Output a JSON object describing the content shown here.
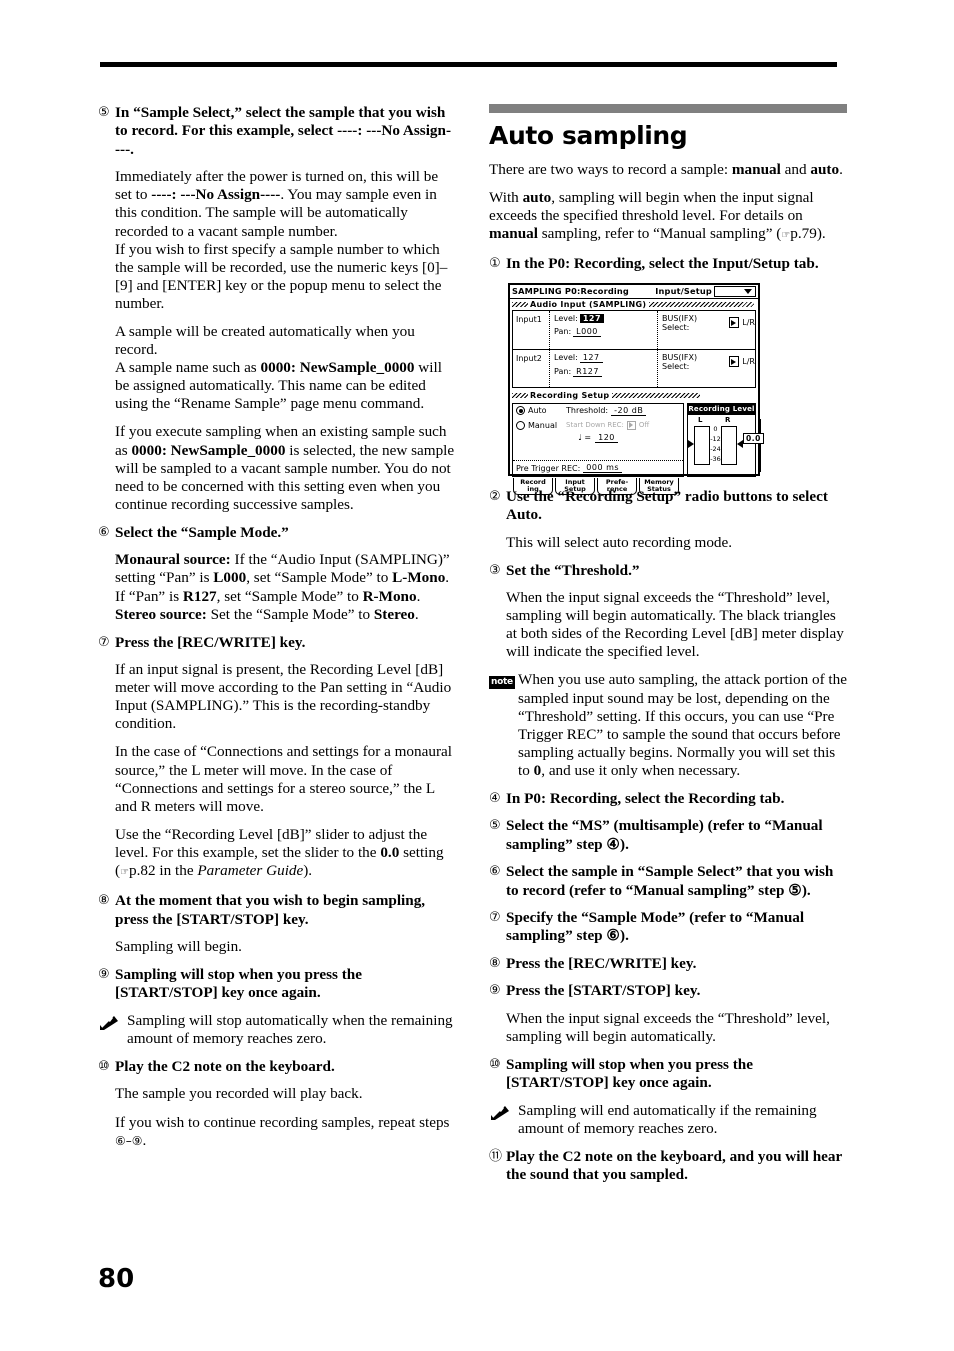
{
  "page_number": "80",
  "left_column": {
    "steps": [
      {
        "num": "⑤",
        "heading": "In “Sample Select,” select the sample that you wish to record. For this example, select ----: ---No Assign----.",
        "paragraphs": [
          "Immediately after the power is turned on, this will be set to ----: ---No Assign----. You may sample even in this condition. The sample will be automatically recorded to a vacant sample number.\nIf you wish to first specify a sample number to which the sample will be recorded, use the numeric keys [0]–[9] and [ENTER] key or the popup menu to select the number.",
          "A sample will be created automatically when you record.\nA sample name such as 0000: NewSample_0000 will be assigned automatically. This name can be edited using the “Rename Sample” page menu command.",
          "If you execute sampling when an existing sample such as 0000: NewSample_0000 is selected, the new sample will be sampled to a vacant sample number. You do not need to be concerned with this setting even when you continue recording successive samples."
        ]
      },
      {
        "num": "⑥",
        "heading": "Select the “Sample Mode.”",
        "paragraphs": [
          "Monaural source: If the “Audio Input (SAMPLING)” setting “Pan” is L000, set “Sample Mode” to L-Mono. If “Pan” is R127, set “Sample Mode” to R-Mono.\nStereo source: Set the “Sample Mode” to Stereo."
        ]
      },
      {
        "num": "⑦",
        "heading": "Press the [REC/WRITE] key.",
        "paragraphs": [
          "If an input signal is present, the Recording Level [dB] meter will move according to the Pan setting in “Audio Input (SAMPLING).” This is the recording-standby condition.",
          "In the case of “Connections and settings for a monaural source,” the L meter will move. In the case of “Connections and settings for a stereo source,” the L and R meters will move.",
          "Use the “Recording Level [dB]” slider to adjust the level. For this example, set the slider to the 0.0 setting (☚p.82 in the Parameter Guide)."
        ]
      },
      {
        "num": "⑧",
        "heading": "At the moment that you wish to begin sampling, press the [START/STOP] key.",
        "paragraphs": [
          "Sampling will begin."
        ]
      },
      {
        "num": "⑨",
        "heading": "Sampling will stop when you press the [START/STOP] key once again.",
        "paragraphs": []
      }
    ],
    "warning_note": "Sampling will stop automatically when the remaining amount of memory reaches zero.",
    "final_step": {
      "num": "⑩",
      "heading": "Play the C2 note on the keyboard.",
      "paragraphs": [
        "The sample you recorded will play back.",
        "If you wish to continue recording samples, repeat steps ⑥–⑨."
      ]
    }
  },
  "right_column": {
    "section_title": "Auto sampling",
    "intro": [
      "There are two ways to record a sample: manual and auto.",
      "With auto, sampling will begin when the input signal exceeds the specified threshold level. For details on manual sampling, refer to “Manual sampling” (☚p.79)."
    ],
    "step1": {
      "num": "①",
      "heading": "In the P0: Recording, select the Input/Setup tab."
    },
    "steps_after": [
      {
        "num": "②",
        "heading": "Use the “Recording Setup” radio buttons to select Auto.",
        "paragraphs": [
          "This will select auto recording mode."
        ]
      },
      {
        "num": "③",
        "heading": "Set the “Threshold.”",
        "paragraphs": [
          "When the input signal exceeds the “Threshold” level, sampling will begin automatically. The black triangles at both sides of the Recording Level [dB] meter display will indicate the specified level."
        ]
      }
    ],
    "note_badge": "note",
    "note_text": "When you use auto sampling, the attack portion of the sampled input sound may be lost, depending on the “Threshold” setting. If this occurs, you can use “Pre Trigger REC” to sample the sound that occurs before sampling actually begins. Normally you will set this to 0, and use it only when necessary.",
    "steps_tail": [
      {
        "num": "④",
        "heading": "In P0: Recording, select the Recording tab.",
        "paragraphs": []
      },
      {
        "num": "⑤",
        "heading": "Select the “MS” (multisample) (refer to “Manual sampling” step ④).",
        "paragraphs": []
      },
      {
        "num": "⑥",
        "heading": "Select the sample in “Sample Select” that you wish to record (refer to “Manual sampling” step ⑤).",
        "paragraphs": []
      },
      {
        "num": "⑦",
        "heading": "Specify the “Sample Mode” (refer to “Manual sampling” step ⑥).",
        "paragraphs": []
      },
      {
        "num": "⑧",
        "heading": "Press the [REC/WRITE] key.",
        "paragraphs": []
      },
      {
        "num": "⑨",
        "heading": "Press the [START/STOP] key.",
        "paragraphs": [
          "When the input signal exceeds the “Threshold” level, sampling will begin automatically."
        ]
      },
      {
        "num": "⑩",
        "heading": "Sampling will stop when you press the [START/STOP] key once again.",
        "paragraphs": []
      }
    ],
    "warning_note": "Sampling will end automatically if the remaining amount of memory reaches zero.",
    "last_step": {
      "num": "⑪",
      "heading": "Play the C2 note on the keyboard, and you will hear the sound that you sampled."
    }
  },
  "lcd": {
    "title_left": "SAMPLING P0:Recording",
    "title_right": "Input/Setup",
    "audio_group_label": "Audio Input (SAMPLING)",
    "inputs": [
      {
        "name": "Input1",
        "level_label": "Level:",
        "level_value": "127",
        "level_selected": true,
        "pan_label": "Pan:",
        "pan_value": "L000",
        "bus_label": "BUS(IFX) Select:",
        "bus_value": "L/R"
      },
      {
        "name": "Input2",
        "level_label": "Level:",
        "level_value": "127",
        "level_selected": false,
        "pan_label": "Pan:",
        "pan_value": "R127",
        "bus_label": "BUS(IFX) Select:",
        "bus_value": "L/R"
      }
    ],
    "recording_group_label": "Recording Setup",
    "auto_label": "Auto",
    "auto_selected": true,
    "threshold_label": "Threshold:",
    "threshold_value": "-20 dB",
    "manual_label": "Manual",
    "manual_selected": false,
    "manual_dim_label": "Start Down REC:",
    "manual_dim_value": "Off",
    "tempo_label": "♩ =",
    "tempo_value": "120",
    "pretrigger_label": "Pre Trigger REC:",
    "pretrigger_value": "000 ms",
    "meter_title": "Recording Level [dB]",
    "meter_l": "L",
    "meter_r": "R",
    "meter_scale": [
      "0",
      "-12",
      "-24",
      "-36"
    ],
    "slider_value": "0.0",
    "tabs": [
      {
        "l1": "Record",
        "l2": "ing"
      },
      {
        "l1": "Input",
        "l2": "Setup"
      },
      {
        "l1": "Prefe-",
        "l2": "rence"
      },
      {
        "l1": "Memory",
        "l2": "Status"
      }
    ]
  }
}
